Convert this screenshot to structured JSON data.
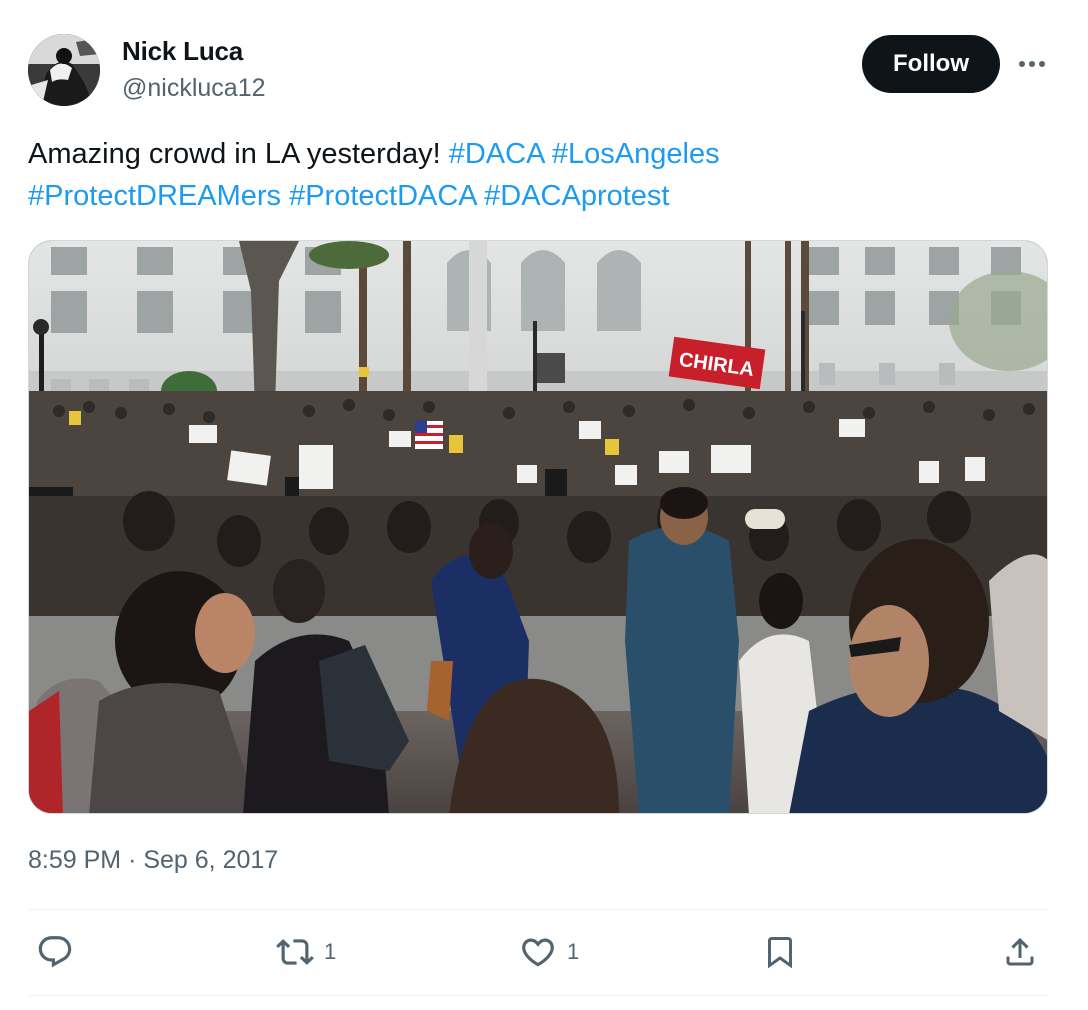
{
  "author": {
    "display_name": "Nick Luca",
    "handle": "@nickluca12"
  },
  "follow_label": "Follow",
  "tweet": {
    "text_plain": "Amazing crowd in LA yesterday!",
    "hashtags": [
      "#DACA",
      "#LosAngeles",
      "#ProtectDREAMers",
      "#ProtectDACA",
      "#DACAprotest"
    ]
  },
  "media": {
    "banner_text": "CHIRLA"
  },
  "timestamp": {
    "time": "8:59 PM",
    "separator": "·",
    "date": "Sep 6, 2017"
  },
  "actions": {
    "reply_count": "",
    "retweet_count": "1",
    "like_count": "1"
  },
  "icons": {
    "reply": "reply-icon",
    "retweet": "retweet-icon",
    "like": "heart-icon",
    "bookmark": "bookmark-icon",
    "share": "share-icon",
    "more": "more-icon"
  },
  "colors": {
    "link": "#1d9bf0",
    "text": "#0f1419",
    "secondary": "#536471",
    "follow_bg": "#0f1419",
    "banner": "#c8202a"
  }
}
